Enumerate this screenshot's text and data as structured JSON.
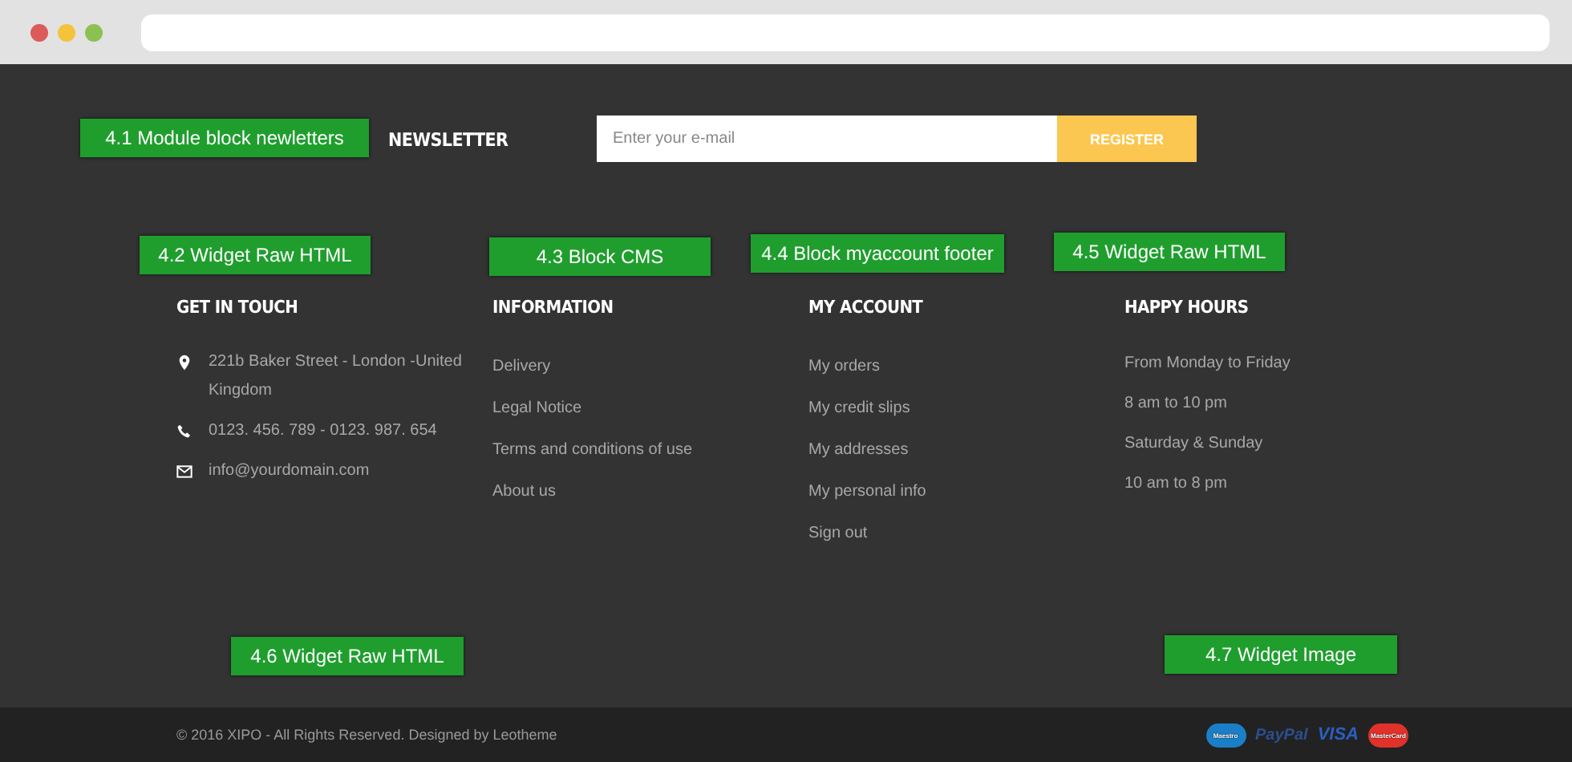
{
  "newsletter": {
    "title": "NEWSLETTER",
    "placeholder": "Enter your e-mail",
    "button": "REGISTER"
  },
  "annotations": [
    "4.1 Module block newletters",
    "4.2 Widget Raw HTML",
    "4.3 Block CMS",
    "4.4 Block myaccount footer",
    "4.5 Widget Raw HTML",
    "4.6 Widget Raw HTML",
    "4.7 Widget Image"
  ],
  "columns": [
    {
      "title": "GET IN TOUCH",
      "kind": "contact",
      "items": [
        {
          "text": "221b Baker Street - London -United Kingdom"
        },
        {
          "text": "0123. 456. 789 - 0123. 987. 654"
        },
        {
          "text": "info@yourdomain.com"
        }
      ]
    },
    {
      "title": "INFORMATION",
      "kind": "links",
      "items": [
        {
          "text": "Delivery"
        },
        {
          "text": "Legal Notice"
        },
        {
          "text": "Terms and conditions of use"
        },
        {
          "text": "About us"
        }
      ]
    },
    {
      "title": "MY ACCOUNT",
      "kind": "links",
      "items": [
        {
          "text": "My orders"
        },
        {
          "text": "My credit slips"
        },
        {
          "text": "My addresses"
        },
        {
          "text": "My personal info"
        },
        {
          "text": "Sign out"
        }
      ]
    },
    {
      "title": "HAPPY HOURS",
      "kind": "text",
      "items": [
        {
          "text": "From Monday to Friday"
        },
        {
          "text": "8 am to 10 pm"
        },
        {
          "text": "Saturday & Sunday"
        },
        {
          "text": "10 am to 8 pm"
        }
      ]
    }
  ],
  "copyright": "© 2016 XIPO - All Rights Reserved. Designed by Leotheme",
  "payments": [
    {
      "kind": "maestro",
      "label": "Maestro"
    },
    {
      "kind": "paypal",
      "label": "PayPal"
    },
    {
      "kind": "visa",
      "label": "VISA"
    },
    {
      "kind": "mastercard",
      "label": "MasterCard"
    }
  ]
}
